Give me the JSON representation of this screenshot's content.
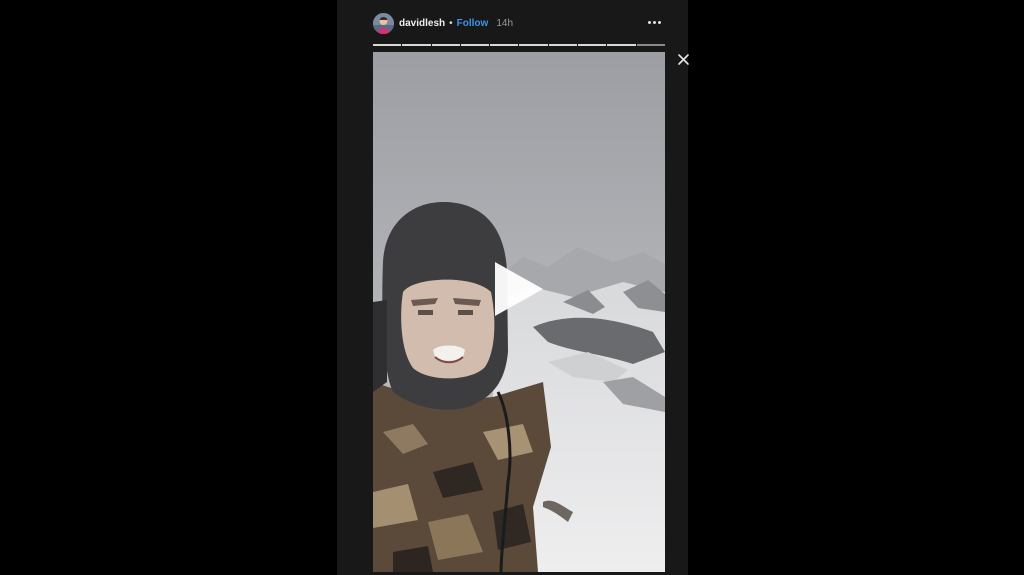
{
  "story": {
    "username": "davidlesh",
    "separator": "•",
    "follow_label": "Follow",
    "timestamp": "14h",
    "progress": {
      "segments": 10,
      "completed": 9
    }
  },
  "icons": {
    "more": "more-horizontal-icon",
    "close": "close-icon",
    "play": "play-icon"
  },
  "colors": {
    "page_background": "#000000",
    "panel_background": "#181818",
    "follow": "#3e94e6"
  }
}
